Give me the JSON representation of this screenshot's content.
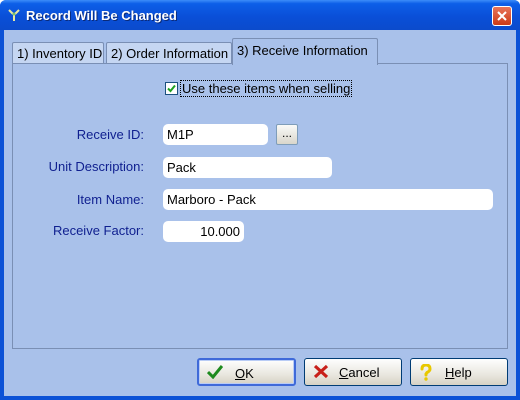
{
  "window": {
    "title": "Record Will Be Changed",
    "close_label": "×"
  },
  "tabs": [
    {
      "label": "1) Inventory ID",
      "active": false
    },
    {
      "label": "2) Order Information",
      "active": false
    },
    {
      "label": "3) Receive Information",
      "active": true
    }
  ],
  "form": {
    "use_items_checkbox": {
      "label": "Use these items when selling",
      "checked": true
    },
    "receive_id": {
      "label": "Receive ID:",
      "value": "M1P",
      "browse_label": "..."
    },
    "unit_description": {
      "label": "Unit Description:",
      "value": "Pack"
    },
    "item_name": {
      "label": "Item Name:",
      "value": "Marboro - Pack"
    },
    "receive_factor": {
      "label": "Receive Factor:",
      "value": "10.000"
    }
  },
  "buttons": {
    "ok": "OK",
    "cancel": "Cancel",
    "help": "Help"
  },
  "colors": {
    "titlebar": "#0b4bcc",
    "panel": "#a9c1ea",
    "label_text": "#0f1f8f",
    "ok_check": "#1e8a1e",
    "cancel_x": "#c8201a",
    "help_question": "#f0d000"
  },
  "icons": [
    "app-icon",
    "close-icon",
    "checkmark-icon",
    "ok-check-icon",
    "cancel-x-icon",
    "help-question-icon"
  ]
}
